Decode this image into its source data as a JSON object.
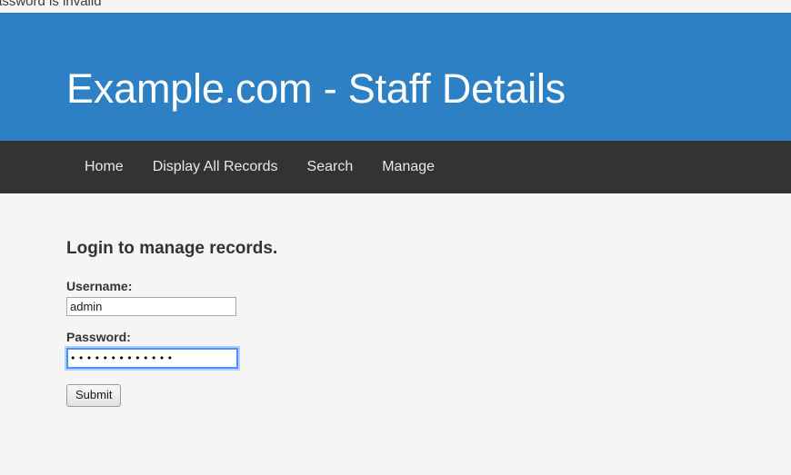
{
  "alert": {
    "message": "assword is invalid",
    "full_message_hint": "assword is invalid"
  },
  "banner": {
    "title": "Example.com - Staff Details",
    "background_color": "#2e80c4",
    "text_color": "#ffffff"
  },
  "nav": {
    "background_color": "#333333",
    "items": [
      {
        "label": "Home"
      },
      {
        "label": "Display All Records"
      },
      {
        "label": "Search"
      },
      {
        "label": "Manage"
      }
    ]
  },
  "main": {
    "heading": "Login to manage records.",
    "form": {
      "username": {
        "label": "Username:",
        "value": "admin",
        "placeholder": ""
      },
      "password": {
        "label": "Password:",
        "value": "•••••••••••••",
        "masked_char_count": 13,
        "placeholder": "",
        "focused": true,
        "focus_ring_color": "#4d90fe"
      },
      "submit_label": "Submit"
    }
  },
  "page": {
    "background_color": "#f5f5f5",
    "text_color": "#333333"
  }
}
